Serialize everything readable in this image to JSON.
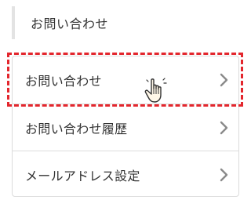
{
  "section": {
    "title": "お問い合わせ"
  },
  "menu": {
    "items": [
      {
        "label": "お問い合わせ",
        "icon": "chevron-right-icon"
      },
      {
        "label": "お問い合わせ履歴",
        "icon": "chevron-right-icon"
      },
      {
        "label": "メールアドレス設定",
        "icon": "chevron-right-icon"
      }
    ]
  },
  "colors": {
    "highlight": "#e3262d",
    "border": "#dcdcdc",
    "header_bar": "#e3e3e3",
    "text": "#333333",
    "chevron": "#8a8a8a"
  },
  "annotation": {
    "cursor": "pointer-hand-icon"
  }
}
